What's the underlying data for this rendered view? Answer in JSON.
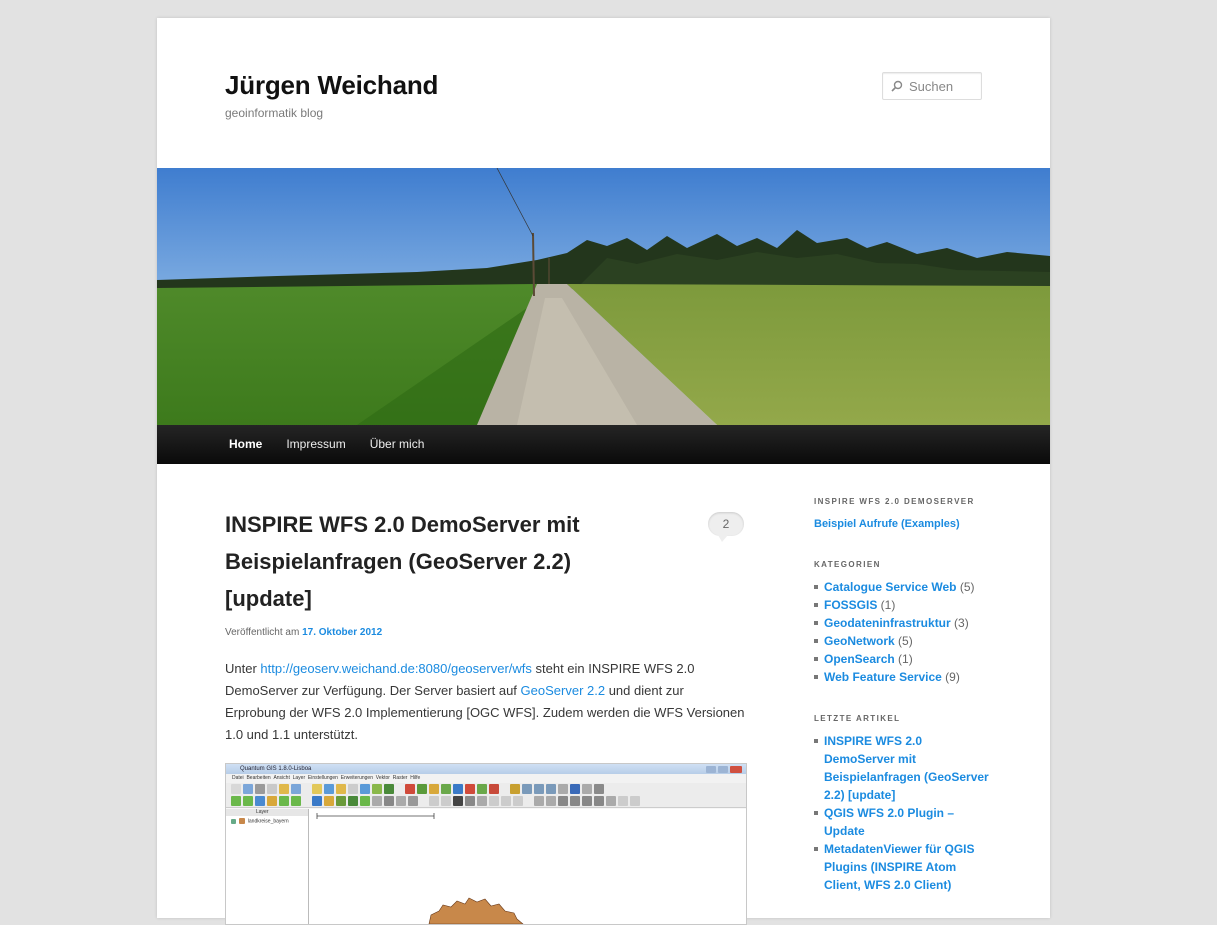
{
  "site": {
    "title": "Jürgen Weichand",
    "description": "geoinformatik blog"
  },
  "search": {
    "placeholder": "Suchen"
  },
  "nav": {
    "items": [
      "Home",
      "Impressum",
      "Über mich"
    ]
  },
  "post": {
    "title": "INSPIRE WFS 2.0 DemoServer mit Beispielanfragen (GeoServer 2.2) [update]",
    "comment_count": "2",
    "meta_prefix": "Veröffentlicht am",
    "date": "17. Oktober 2012",
    "p_part1": "Unter ",
    "p_link1": "http://geoserv.weichand.de:8080/geoserver/wfs",
    "p_part2": " steht ein INSPIRE WFS 2.0 DemoServer zur Verfügung. Der Server basiert auf ",
    "p_link2": "GeoServer 2.2",
    "p_part3": " und dient zur Erprobung der WFS 2.0 Implementierung [OGC WFS]. Zudem werden die WFS Versionen 1.0 und 1.1 unterstützt."
  },
  "qgis": {
    "window_title": "Quantum GIS 1.8.0-Lisboa",
    "menu": [
      "Datei",
      "Bearbeiten",
      "Ansicht",
      "Layer",
      "Einstellungen",
      "Erweiterungen",
      "Vektor",
      "Raster",
      "Hilfe"
    ],
    "layer_name": "landkreise_bayern",
    "layer_panel_label": "Layer"
  },
  "sidebar": {
    "demoserver": {
      "title": "INSPIRE WFS 2.0 DEMOSERVER",
      "link": "Beispiel Aufrufe (Examples)"
    },
    "categories": {
      "title": "KATEGORIEN",
      "items": [
        {
          "label": "Catalogue Service Web",
          "count": " (5)"
        },
        {
          "label": "FOSSGIS",
          "count": " (1)"
        },
        {
          "label": "Geodateninfrastruktur",
          "count": " (3)"
        },
        {
          "label": "GeoNetwork",
          "count": " (5)"
        },
        {
          "label": "OpenSearch",
          "count": " (1)"
        },
        {
          "label": "Web Feature Service",
          "count": " (9)"
        }
      ]
    },
    "recent": {
      "title": "LETZTE ARTIKEL",
      "items": [
        "INSPIRE WFS 2.0 DemoServer mit Beispielanfragen (GeoServer 2.2) [update]",
        "QGIS WFS 2.0 Plugin – Update",
        "MetadatenViewer für QGIS Plugins (INSPIRE Atom Client, WFS 2.0 Client)"
      ]
    }
  },
  "colors": {
    "link": "#1b8be0",
    "nav_bg": "#1a1a1a",
    "page_bg": "#e2e2e2"
  }
}
